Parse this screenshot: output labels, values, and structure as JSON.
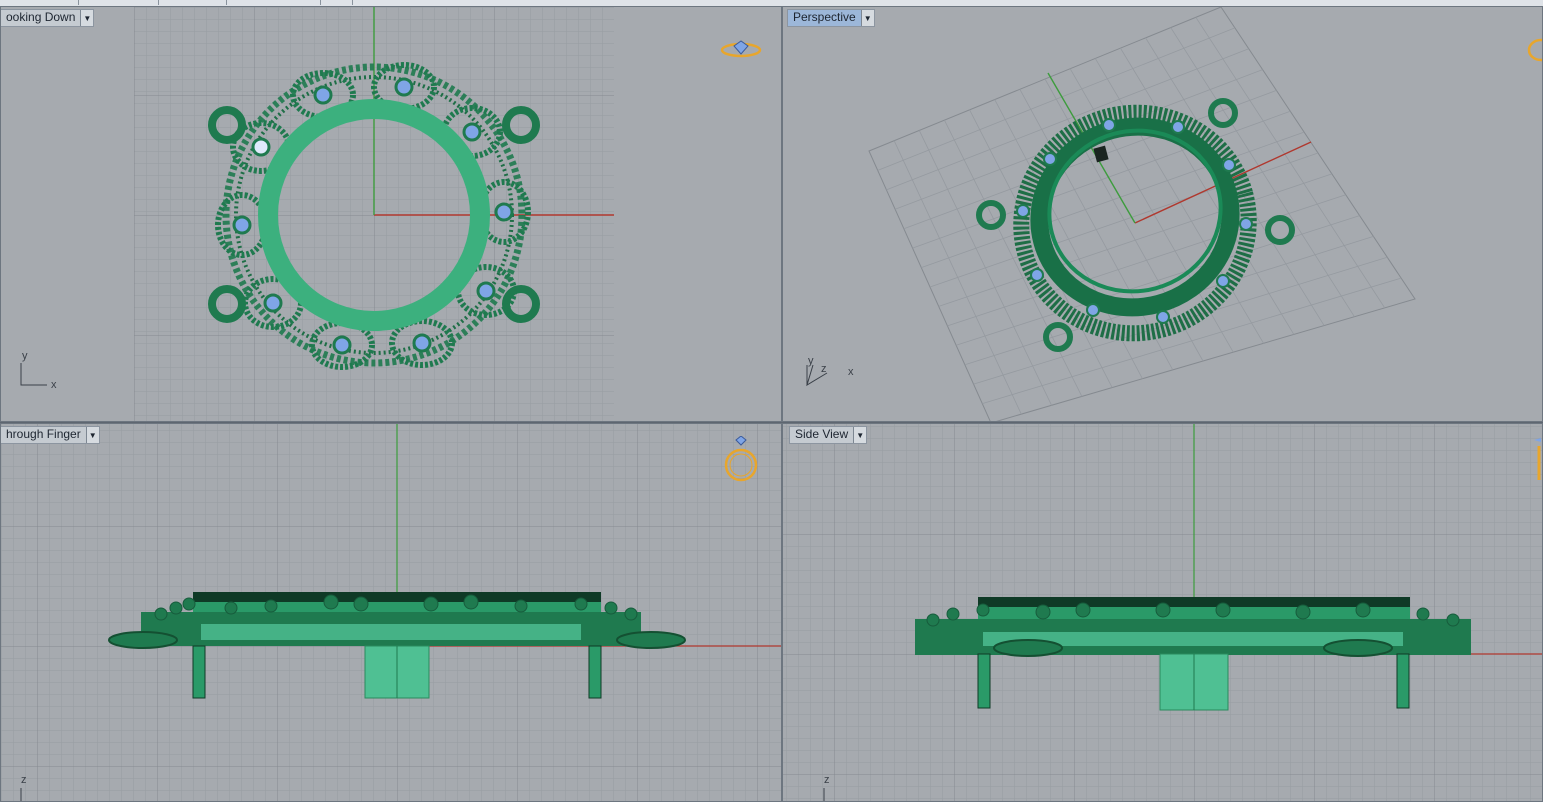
{
  "viewports": {
    "top": {
      "label": "ooking Down",
      "axis_x": "x",
      "axis_y": "y"
    },
    "perspective": {
      "label": "Perspective",
      "axis_x": "x",
      "axis_y": "y",
      "axis_z": "z"
    },
    "front": {
      "label": "hrough Finger",
      "axis_z": "z"
    },
    "side": {
      "label": "Side View",
      "axis_z": "z"
    }
  },
  "icons": {
    "dropdown": "chevron-down-icon",
    "view_cube": "ring-view-icon"
  },
  "colors": {
    "model_dark": "#1f7a4f",
    "model_light": "#4fc093",
    "gem": "#7fa5e6",
    "viewport_bg": "#a6aaaf",
    "grid": "#959aa0",
    "axis_x": "#b0382e",
    "axis_y": "#3d9c3d",
    "active_label": "#9cb7d9",
    "ring_icon": "#e8a62c"
  }
}
